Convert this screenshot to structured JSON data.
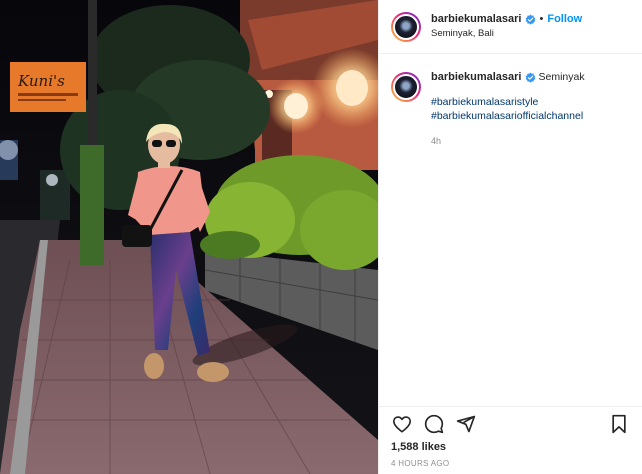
{
  "post": {
    "username": "barbiekumalasari",
    "follow_label": "Follow",
    "dot": "•",
    "location": "Seminyak, Bali",
    "caption": {
      "username": "barbiekumalasari",
      "location_text": "Seminyak",
      "hashtags": [
        "#barbiekumalasaristyle",
        "#barbiekumalasariofficialchannel"
      ],
      "age": "4h"
    },
    "likes": "1,588 likes",
    "time_ago": "4 HOURS AGO"
  },
  "photo": {
    "sign_text": "Kuni's",
    "description_icon": "photo-of-woman-on-street-at-night"
  },
  "icons": {
    "like": "heart-icon",
    "comment": "comment-icon",
    "share": "paper-plane-icon",
    "save": "bookmark-icon",
    "verified": "verified-badge-icon"
  },
  "colors": {
    "link": "#0095f6",
    "hashtag": "#00376b",
    "muted": "#8e8e8e",
    "text": "#262626"
  }
}
